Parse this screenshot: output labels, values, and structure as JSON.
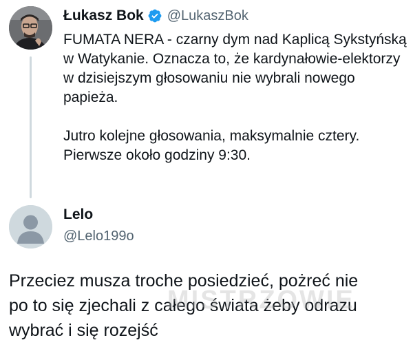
{
  "post": {
    "author_name": "Łukasz Bok",
    "author_handle": "@LukaszBok",
    "verified_icon": "verified-badge-icon",
    "paragraph_1": "FUMATA NERA - czarny dym nad Kaplicą Sykstyńską w Watykanie. Oznacza to, że kardynałowie-elektorzy w dzisiejszym głosowaniu nie wybrali nowego papieża.",
    "paragraph_2": "Jutro kolejne głosowania, maksymalnie cztery. Pierwsze około godziny 9:30."
  },
  "reply_author": {
    "name": "Lelo",
    "handle": "@Lelo199o"
  },
  "reply": {
    "line_1": "Przeciez musza troche posiedzieć, pożreć nie",
    "line_2": "po to się zjechali z całego świata żeby odrazu",
    "line_3": "wybrać i się rozejść"
  },
  "watermark": "MISTRZOWIE",
  "colors": {
    "verified": "#1d9bf0",
    "secondary_text": "#536471",
    "thread_line": "#cfd9de"
  }
}
